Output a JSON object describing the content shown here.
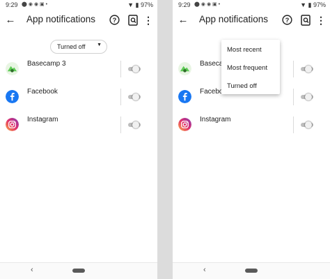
{
  "status_bar": {
    "time": "9:29",
    "battery": "97%"
  },
  "app_bar": {
    "title": "App notifications"
  },
  "sort": {
    "selected": "Turned off"
  },
  "apps": [
    {
      "name": "Basecamp 3",
      "icon": "basecamp-icon",
      "enabled": false
    },
    {
      "name": "Facebook",
      "icon": "facebook-icon",
      "enabled": false
    },
    {
      "name": "Instagram",
      "icon": "instagram-icon",
      "enabled": false
    }
  ],
  "menu": {
    "items": [
      {
        "label": "Most recent"
      },
      {
        "label": "Most frequent"
      },
      {
        "label": "Turned off"
      }
    ]
  },
  "colors": {
    "facebook": "#1877f2",
    "toggle_track": "#bdbdbd",
    "basecamp": "#5ecb56"
  }
}
